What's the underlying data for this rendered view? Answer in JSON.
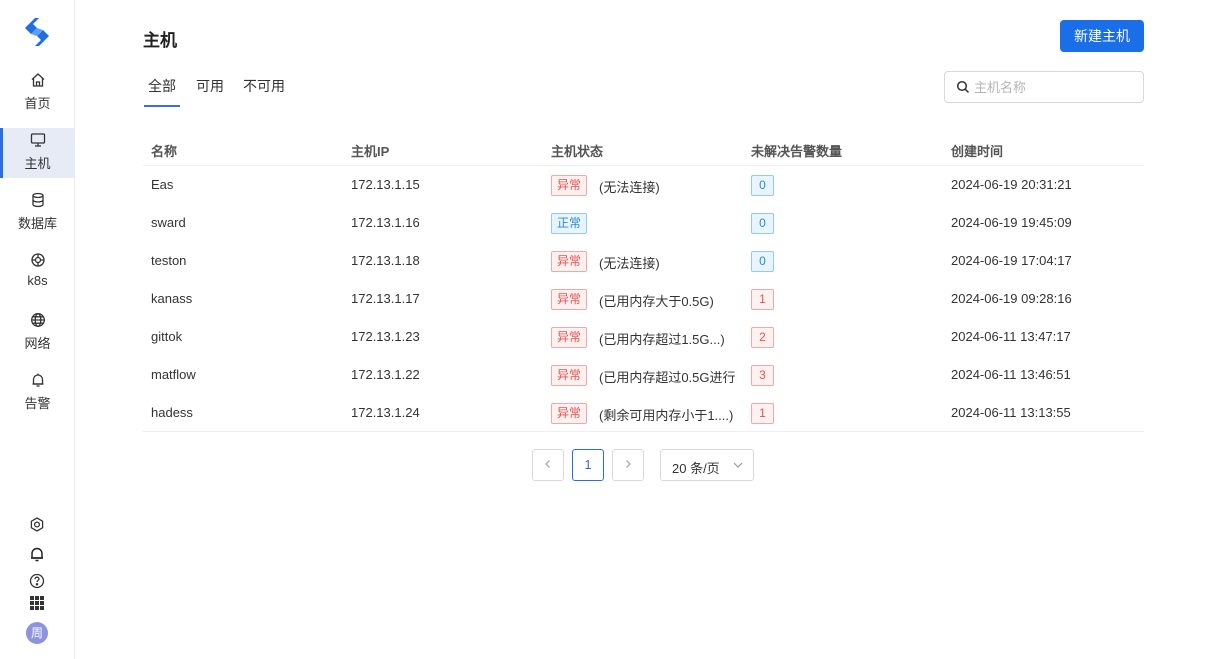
{
  "sidebar": {
    "items": [
      {
        "label": "首页",
        "icon": "home-icon"
      },
      {
        "label": "主机",
        "icon": "monitor-icon",
        "active": true
      },
      {
        "label": "数据库",
        "icon": "database-icon"
      },
      {
        "label": "k8s",
        "icon": "kubernetes-icon"
      },
      {
        "label": "网络",
        "icon": "globe-icon"
      },
      {
        "label": "告警",
        "icon": "bell-icon"
      }
    ],
    "bottom_icons": [
      "settings-icon",
      "notification-bell-icon",
      "help-icon",
      "apps-grid-icon"
    ],
    "avatar_text": "周"
  },
  "header": {
    "title": "主机",
    "new_button": "新建主机"
  },
  "tabs": [
    {
      "label": "全部",
      "active": true
    },
    {
      "label": "可用"
    },
    {
      "label": "不可用"
    }
  ],
  "search": {
    "placeholder": "主机名称",
    "value": ""
  },
  "table": {
    "columns": [
      "名称",
      "主机IP",
      "主机状态",
      "未解决告警数量",
      "创建时间"
    ],
    "rows": [
      {
        "name": "Eas",
        "ip": "172.13.1.15",
        "status": "异常",
        "status_type": "bad",
        "note": "(无法连接)",
        "alerts": "0",
        "created": "2024-06-19 20:31:21"
      },
      {
        "name": "sward",
        "ip": "172.13.1.16",
        "status": "正常",
        "status_type": "good",
        "note": "",
        "alerts": "0",
        "created": "2024-06-19 19:45:09"
      },
      {
        "name": "teston",
        "ip": "172.13.1.18",
        "status": "异常",
        "status_type": "bad",
        "note": "(无法连接)",
        "alerts": "0",
        "created": "2024-06-19 17:04:17"
      },
      {
        "name": "kanass",
        "ip": "172.13.1.17",
        "status": "异常",
        "status_type": "bad",
        "note": "(已用内存大于0.5G)",
        "alerts": "1",
        "created": "2024-06-19 09:28:16"
      },
      {
        "name": "gittok",
        "ip": "172.13.1.23",
        "status": "异常",
        "status_type": "bad",
        "note": "(已用内存超过1.5G...)",
        "alerts": "2",
        "created": "2024-06-11 13:47:17"
      },
      {
        "name": "matflow",
        "ip": "172.13.1.22",
        "status": "异常",
        "status_type": "bad",
        "note": "(已用内存超过0.5G进行",
        "alerts": "3",
        "created": "2024-06-11 13:46:51"
      },
      {
        "name": "hadess",
        "ip": "172.13.1.24",
        "status": "异常",
        "status_type": "bad",
        "note": "(剩余可用内存小于1....)",
        "alerts": "1",
        "created": "2024-06-11 13:13:55"
      }
    ]
  },
  "pagination": {
    "prev": "<",
    "current_page": "1",
    "next": ">",
    "page_size": "20 条/页"
  },
  "colors": {
    "accent": "#1a6ee8",
    "error_text": "#e35353",
    "info_text": "#2d8ad8"
  }
}
